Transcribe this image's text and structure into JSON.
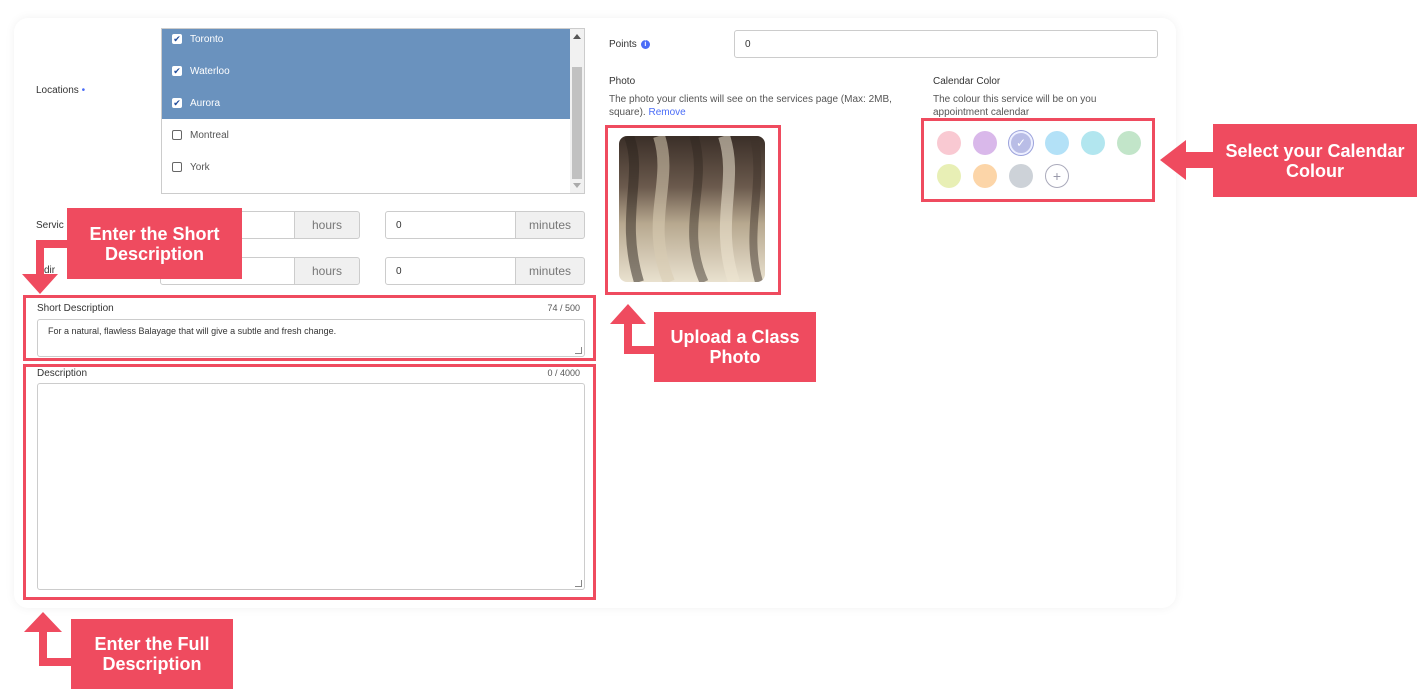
{
  "form": {
    "locations_label": "Locations",
    "required_marker": "•",
    "locations": [
      {
        "label": "Toronto",
        "checked": true
      },
      {
        "label": "Waterloo",
        "checked": true
      },
      {
        "label": "Aurora",
        "checked": true
      },
      {
        "label": "Montreal",
        "checked": false
      },
      {
        "label": "York",
        "checked": false
      }
    ],
    "service_label_partial": "Servic",
    "buffer_label_partial": "dir",
    "service_hours_unit": "hours",
    "service_minutes_value": "0",
    "service_minutes_unit": "minutes",
    "buffer_hours_unit": "hours",
    "buffer_minutes_value": "0",
    "buffer_minutes_unit": "minutes",
    "short_description_label": "Short Description",
    "short_description_counter": "74 / 500",
    "short_description_value": "For a natural, flawless Balayage that will give a subtle and fresh change.",
    "description_label": "Description",
    "description_counter": "0 / 4000",
    "description_value": ""
  },
  "right": {
    "points_label": "Points",
    "points_info_icon": "i",
    "points_value": "0",
    "photo_label": "Photo",
    "photo_help": "The photo your clients will see on the services page (Max: 2MB, square).",
    "photo_remove": "Remove",
    "calendar_label": "Calendar Color",
    "calendar_help": "The colour this service will be on you appointment calendar",
    "calendar_colors": [
      "#f9c9d2",
      "#d9b8ea",
      "#b9bde6",
      "#b3e1f7",
      "#b2e6ef",
      "#c2e5c9",
      "#e8efb5",
      "#fcd5a8",
      "#cdd2d8"
    ],
    "selected_color_index": 2,
    "add_color_icon": "+"
  },
  "annotations": {
    "short_desc_callout": "Enter the Short Description",
    "full_desc_callout": "Enter the Full Description",
    "photo_callout": "Upload a Class Photo",
    "calendar_callout": "Select your Calendar Colour",
    "accent_color": "#ef4b5f"
  }
}
